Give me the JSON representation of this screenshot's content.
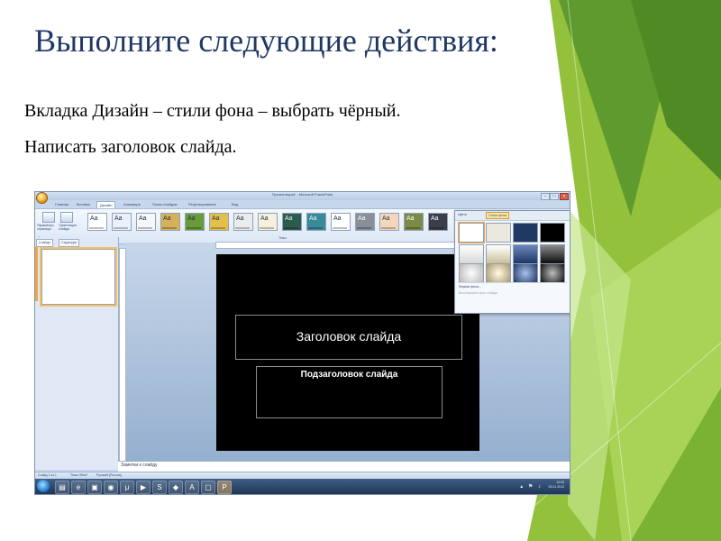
{
  "slide": {
    "title": "Выполните следующие действия:",
    "lines": [
      "Вкладка Дизайн – стили фона – выбрать чёрный.",
      "Написать заголовок слайда."
    ]
  },
  "app": {
    "window_title": "Презентация1 - Microsoft PowerPoint",
    "tabs": [
      "Главная",
      "Вставка",
      "Дизайн",
      "Анимация",
      "Показ слайдов",
      "Рецензирование",
      "Вид"
    ],
    "active_tab": "Дизайн",
    "ribbon": {
      "page_setup_btn": "Параметры страницы",
      "orientation_btn": "Ориентация слайда",
      "group_page_setup": "Параметры страницы",
      "group_themes": "Темы",
      "theme_label": "Aa"
    },
    "left_pane_tabs": [
      "Слайды",
      "Структура"
    ],
    "slide_title_placeholder": "Заголовок слайда",
    "slide_subtitle_placeholder": "Подзаголовок слайда",
    "notes_placeholder": "Заметки к слайду",
    "status": {
      "slide_num": "Слайд 1 из 1",
      "theme": "\"Тема Office\"",
      "language": "Русский (Россия)"
    },
    "background_popup": {
      "colors_btn": "Цвета",
      "styles_btn": "Стили фона",
      "menu_format": "Формат фона...",
      "menu_reset": "Восстановить фон слайда",
      "swatch_colors": [
        "#ffffff",
        "#ebe8e0",
        "#1f3864",
        "#000000"
      ]
    },
    "clock": {
      "time": "10:03",
      "date": "03.01.2012"
    }
  }
}
